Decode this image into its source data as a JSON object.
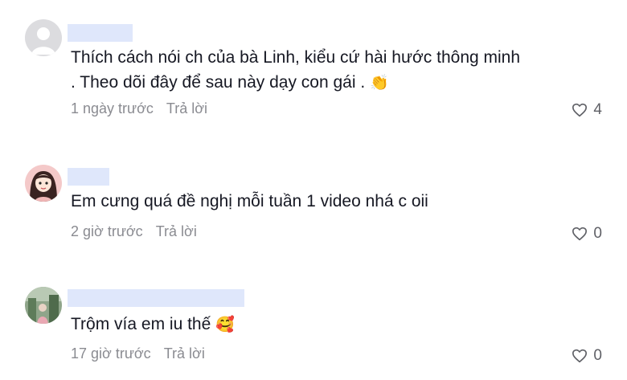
{
  "comments": [
    {
      "text_line1": "Thích cách nói ch của bà Linh, kiểu cứ hài hước thông minh",
      "text_line2": ". Theo dõi đây để sau này dạy con gái .",
      "emoji": "👏",
      "time": "1 ngày trước",
      "reply_label": "Trả lời",
      "likes": "4"
    },
    {
      "text_line1": "Em cưng quá đề nghị mỗi tuần 1 video nhá c oii",
      "time": "2 giờ trước",
      "reply_label": "Trả lời",
      "likes": "0"
    },
    {
      "text_line1": "Trộm vía em iu thế",
      "emoji": "🥰",
      "time": "17 giờ trước",
      "reply_label": "Trả lời",
      "likes": "0"
    }
  ],
  "colors": {
    "text": "#161823",
    "meta": "#8a8b91",
    "name_redaction": "#dfe7fb"
  },
  "icons": [
    "default-avatar-icon",
    "girl-avatar-icon",
    "photo-avatar-icon",
    "heart-icon"
  ]
}
